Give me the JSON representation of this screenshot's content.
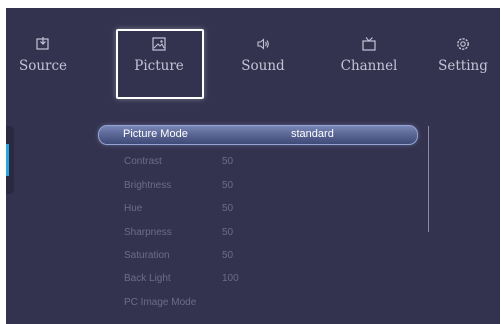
{
  "menu": {
    "items": [
      {
        "label": "Source",
        "icon": "source-icon"
      },
      {
        "label": "Picture",
        "icon": "picture-icon"
      },
      {
        "label": "Sound",
        "icon": "speaker-icon"
      },
      {
        "label": "Channel",
        "icon": "tv-icon"
      },
      {
        "label": "Setting",
        "icon": "gear-icon"
      }
    ],
    "selected": "Picture"
  },
  "picture_mode": {
    "label": "Picture Mode",
    "value": "standard"
  },
  "settings": [
    {
      "label": "Contrast",
      "value": "50"
    },
    {
      "label": "Brightness",
      "value": "50"
    },
    {
      "label": "Hue",
      "value": "50"
    },
    {
      "label": "Sharpness",
      "value": "50"
    },
    {
      "label": "Saturation",
      "value": "50"
    },
    {
      "label": "Back Light",
      "value": "100"
    },
    {
      "label": "PC Image Mode",
      "value": ""
    }
  ],
  "colors": {
    "background": "#34334f",
    "accent": "#25a7d8",
    "focus": "#ffffff",
    "disabled_text": "#6d6c87"
  }
}
